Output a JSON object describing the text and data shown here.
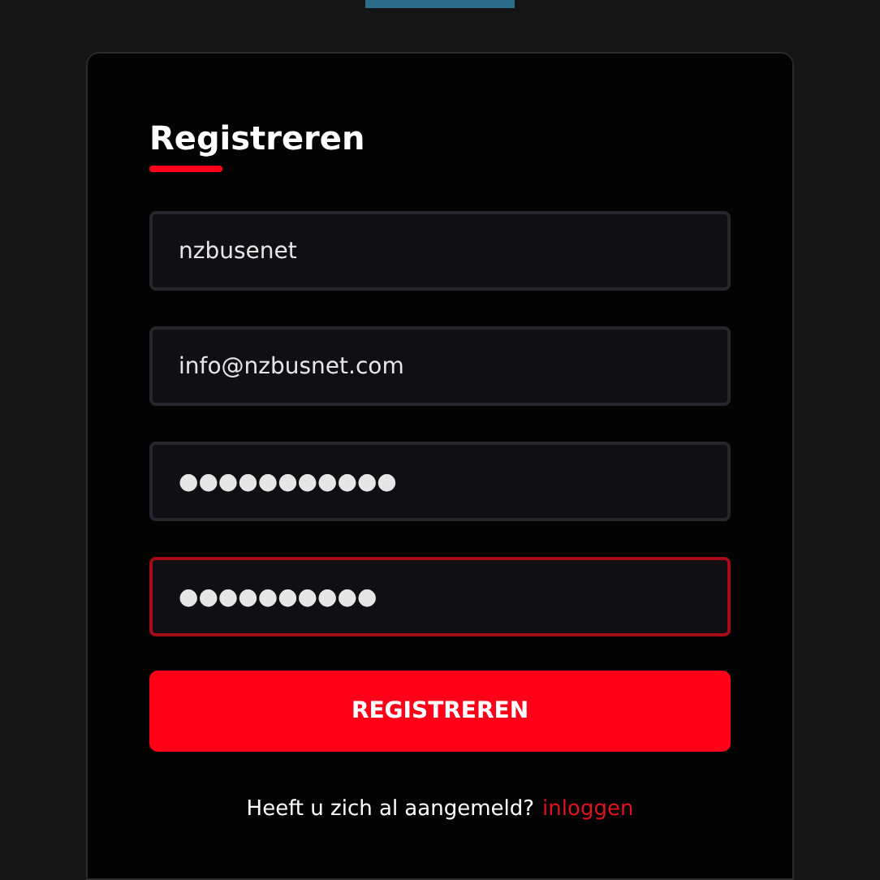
{
  "title": "Registreren",
  "fields": [
    {
      "value": "nzbusenet",
      "focused": false
    },
    {
      "value": "info@nzbusnet.com",
      "focused": false
    },
    {
      "value": "●●●●●●●●●●●",
      "focused": false
    },
    {
      "value": "●●●●●●●●●●",
      "focused": true
    }
  ],
  "submit_button": "REGISTREREN",
  "footer": {
    "text": "Heeft u zich al aangemeld?",
    "link": "inloggen"
  }
}
